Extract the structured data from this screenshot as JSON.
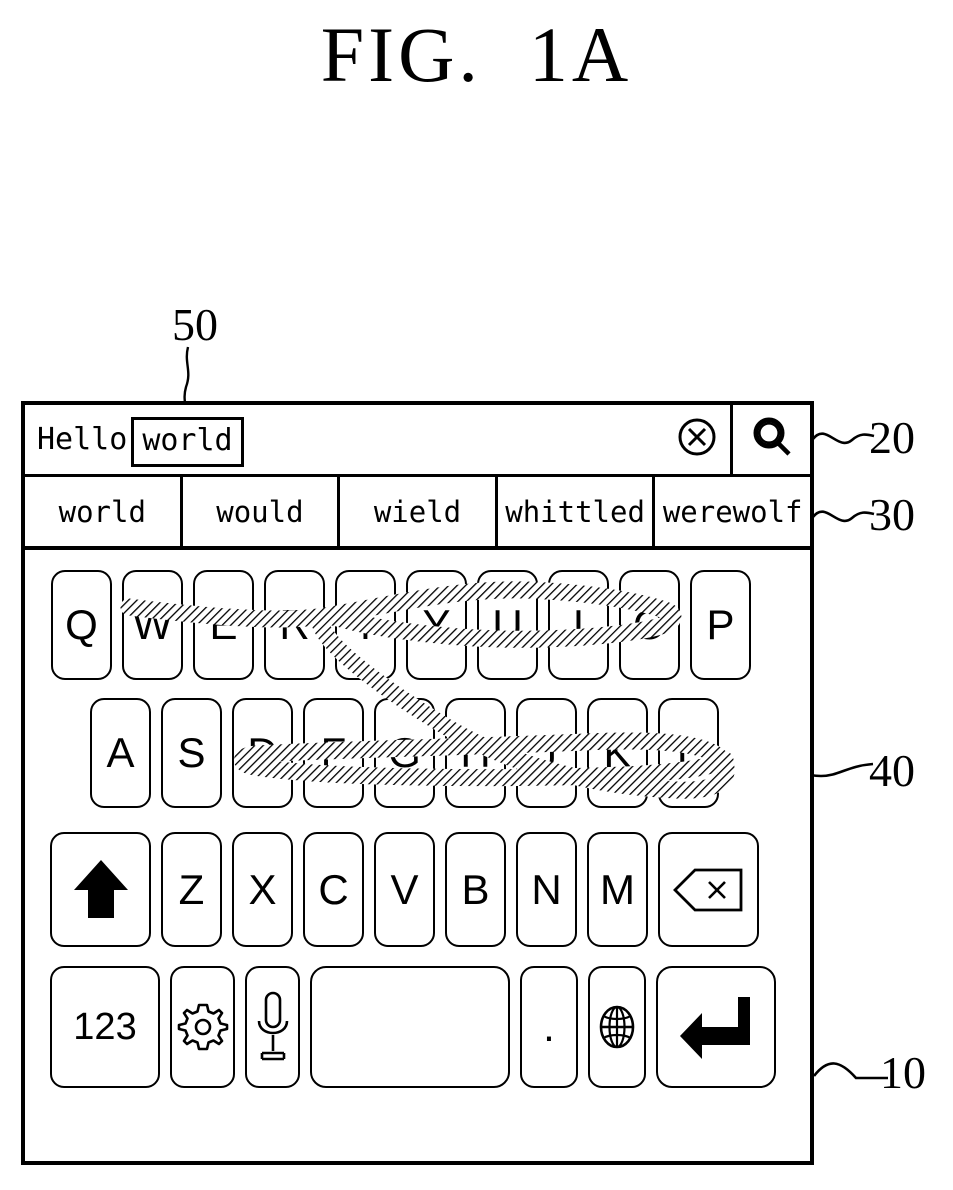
{
  "figure": {
    "title": "FIG.  1A"
  },
  "reference_numerals": {
    "device": "10",
    "text_input_bar": "20",
    "suggestion_bar": "30",
    "keyboard": "40",
    "composing_word": "50"
  },
  "text_input": {
    "committed_text": "Hello",
    "composing_word": "world",
    "clear_icon": "clear-circle-x-icon",
    "search_icon": "search-magnifier-icon"
  },
  "suggestions": [
    {
      "label": "world"
    },
    {
      "label": "would"
    },
    {
      "label": "wield"
    },
    {
      "label": "whittled"
    },
    {
      "label": "werewolf"
    }
  ],
  "keyboard": {
    "row1": [
      {
        "label": "Q",
        "name": "key-q"
      },
      {
        "label": "W",
        "name": "key-w"
      },
      {
        "label": "E",
        "name": "key-e"
      },
      {
        "label": "R",
        "name": "key-r"
      },
      {
        "label": "T",
        "name": "key-t"
      },
      {
        "label": "Y",
        "name": "key-y"
      },
      {
        "label": "U",
        "name": "key-u"
      },
      {
        "label": "I",
        "name": "key-i"
      },
      {
        "label": "O",
        "name": "key-o"
      },
      {
        "label": "P",
        "name": "key-p"
      }
    ],
    "row2": [
      {
        "label": "A",
        "name": "key-a"
      },
      {
        "label": "S",
        "name": "key-s"
      },
      {
        "label": "D",
        "name": "key-d"
      },
      {
        "label": "F",
        "name": "key-f"
      },
      {
        "label": "G",
        "name": "key-g"
      },
      {
        "label": "H",
        "name": "key-h"
      },
      {
        "label": "J",
        "name": "key-j"
      },
      {
        "label": "K",
        "name": "key-k"
      },
      {
        "label": "L",
        "name": "key-l"
      }
    ],
    "row3": [
      {
        "label": "",
        "name": "key-shift",
        "icon": "shift-up-arrow-icon"
      },
      {
        "label": "Z",
        "name": "key-z"
      },
      {
        "label": "X",
        "name": "key-x"
      },
      {
        "label": "C",
        "name": "key-c"
      },
      {
        "label": "V",
        "name": "key-v"
      },
      {
        "label": "B",
        "name": "key-b"
      },
      {
        "label": "N",
        "name": "key-n"
      },
      {
        "label": "M",
        "name": "key-m"
      },
      {
        "label": "",
        "name": "key-backspace",
        "icon": "backspace-delete-icon"
      }
    ],
    "row4": [
      {
        "label": "123",
        "name": "key-numbers"
      },
      {
        "label": "",
        "name": "key-settings",
        "icon": "gear-settings-icon"
      },
      {
        "label": "",
        "name": "key-microphone",
        "icon": "microphone-icon"
      },
      {
        "label": "",
        "name": "key-space",
        "icon": "spacebar"
      },
      {
        "label": ".",
        "name": "key-period"
      },
      {
        "label": "",
        "name": "key-globe",
        "icon": "globe-language-icon"
      },
      {
        "label": "",
        "name": "key-enter",
        "icon": "enter-return-arrow-icon"
      }
    ]
  },
  "gesture": {
    "description": "swipe-trace-overlay",
    "traced_keys": [
      "W",
      "E",
      "R",
      "T",
      "Y",
      "U",
      "I",
      "O",
      "R",
      "D",
      "F",
      "G",
      "H",
      "J",
      "K",
      "L"
    ]
  },
  "colors": {
    "ink": "#000000",
    "background": "#ffffff"
  }
}
